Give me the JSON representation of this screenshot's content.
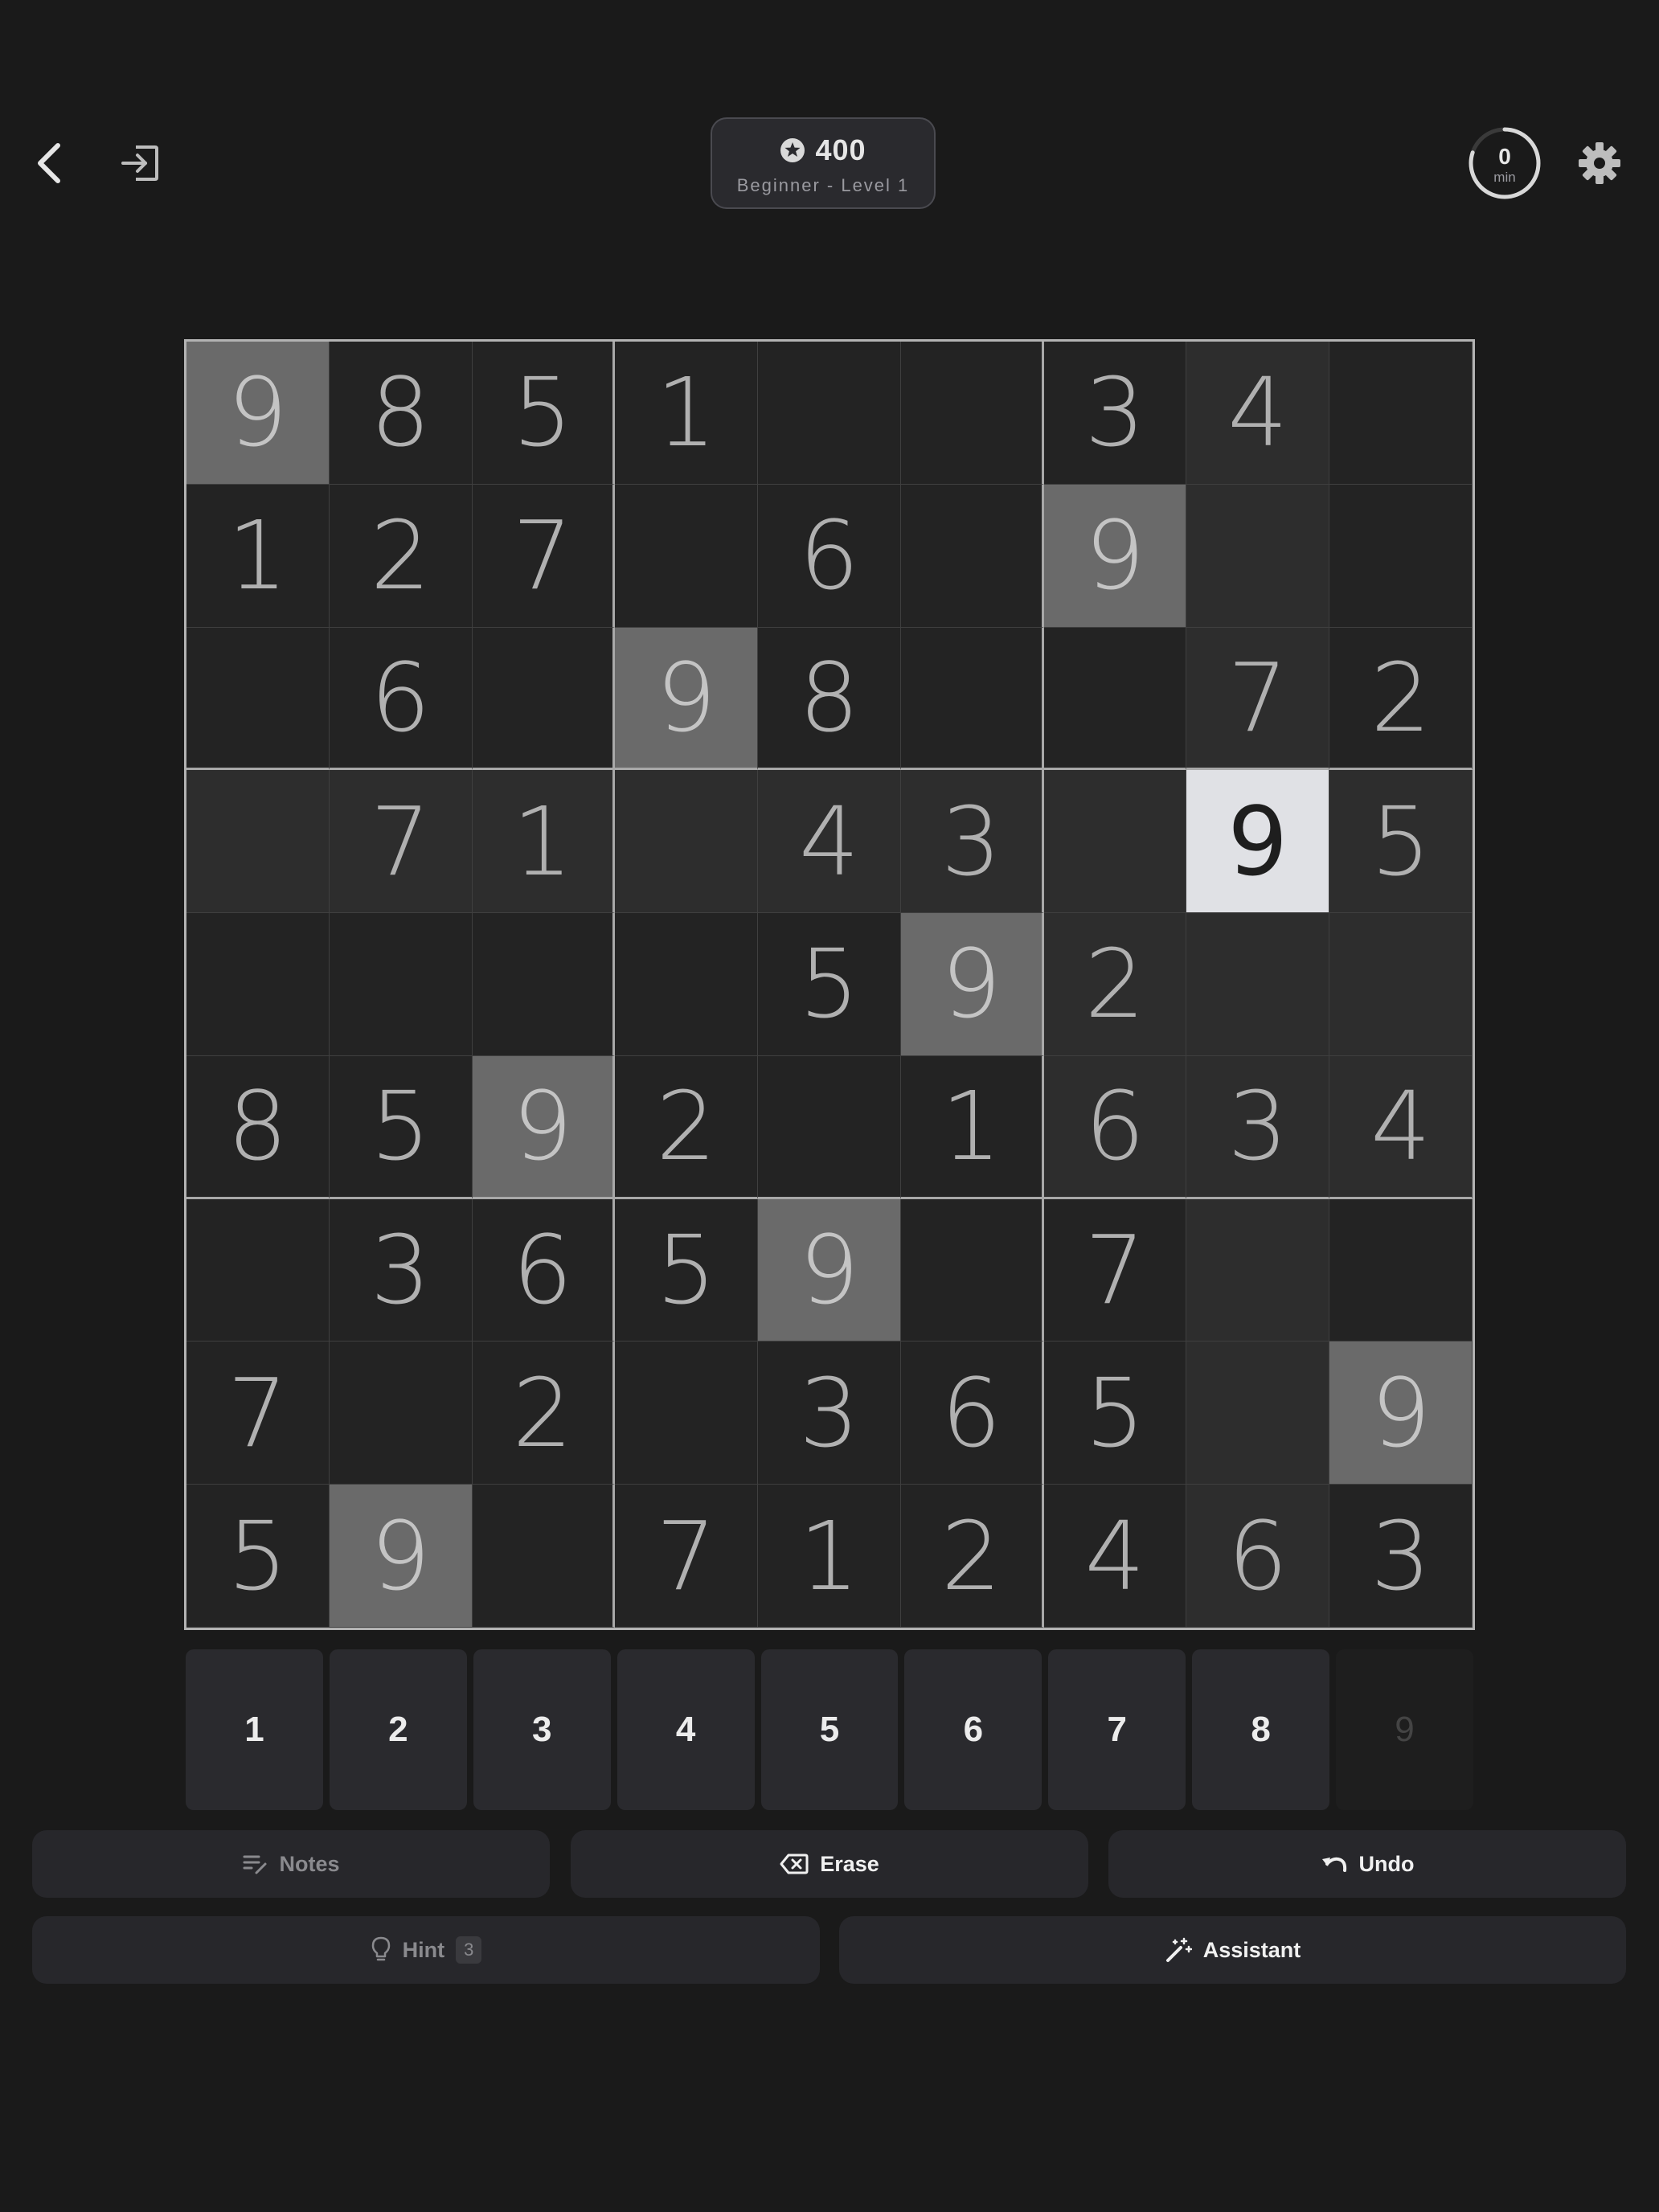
{
  "header": {
    "back_icon": "chevron-left-icon",
    "exit_icon": "exit-icon",
    "settings_icon": "gear-icon",
    "score": "400",
    "score_icon": "star-circle-icon",
    "level": "Beginner - Level 1",
    "timer": {
      "value": "0",
      "unit": "min",
      "progress": 0.8
    }
  },
  "board": {
    "rows": [
      [
        "9",
        "8",
        "5",
        "1",
        "",
        "",
        "3",
        "4",
        ""
      ],
      [
        "1",
        "2",
        "7",
        "",
        "6",
        "",
        "9",
        "",
        ""
      ],
      [
        "",
        "6",
        "",
        "9",
        "8",
        "",
        "",
        "7",
        "2"
      ],
      [
        "",
        "7",
        "1",
        "",
        "4",
        "3",
        "",
        "9",
        "5"
      ],
      [
        "",
        "",
        "",
        "",
        "5",
        "9",
        "2",
        "",
        ""
      ],
      [
        "8",
        "5",
        "9",
        "2",
        "",
        "1",
        "6",
        "3",
        "4"
      ],
      [
        "",
        "3",
        "6",
        "5",
        "9",
        "",
        "7",
        "",
        ""
      ],
      [
        "7",
        "",
        "2",
        "",
        "3",
        "6",
        "5",
        "",
        "9"
      ],
      [
        "5",
        "9",
        "",
        "7",
        "1",
        "2",
        "4",
        "6",
        "3"
      ]
    ],
    "selected": {
      "row": 3,
      "col": 7
    },
    "highlight_value": "9"
  },
  "numpad": [
    {
      "label": "1",
      "disabled": false
    },
    {
      "label": "2",
      "disabled": false
    },
    {
      "label": "3",
      "disabled": false
    },
    {
      "label": "4",
      "disabled": false
    },
    {
      "label": "5",
      "disabled": false
    },
    {
      "label": "6",
      "disabled": false
    },
    {
      "label": "7",
      "disabled": false
    },
    {
      "label": "8",
      "disabled": false
    },
    {
      "label": "9",
      "disabled": true
    }
  ],
  "actions": {
    "notes": {
      "label": "Notes",
      "icon": "notes-pencil-icon"
    },
    "erase": {
      "label": "Erase",
      "icon": "backspace-icon"
    },
    "undo": {
      "label": "Undo",
      "icon": "undo-icon"
    },
    "hint": {
      "label": "Hint",
      "count": "3",
      "icon": "lightbulb-icon"
    },
    "assistant": {
      "label": "Assistant",
      "icon": "magic-wand-icon"
    }
  },
  "colors": {
    "background": "#1a1a1a",
    "cell": "#232323",
    "cell_highlight": "#2d2d2d",
    "same_number": "#6a6a6a",
    "selected": "#e0e1e5"
  }
}
